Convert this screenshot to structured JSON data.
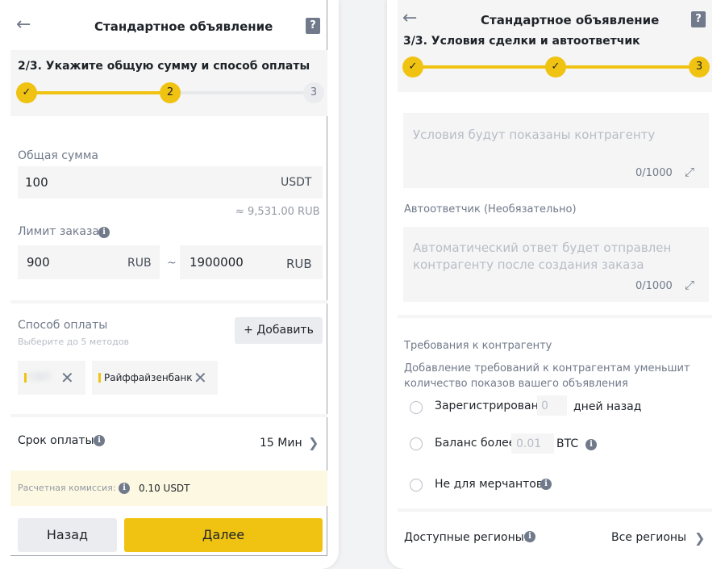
{
  "left": {
    "header": {
      "back_icon": "arrow-left-icon",
      "title": "Стандартное объявление",
      "help_icon": "help-book-icon"
    },
    "step": {
      "title": "2/3. Укажите общую сумму и способ оплаты",
      "current": "2",
      "last": "3",
      "done_icon": "check-icon"
    },
    "total": {
      "label": "Общая сумма",
      "value": "100",
      "unit": "USDT",
      "approx": "≈ 9,531.00 RUB"
    },
    "limit": {
      "label": "Лимит заказа",
      "min": "900",
      "min_unit": "RUB",
      "separator": "~",
      "max": "1900000",
      "max_unit": "RUB"
    },
    "payment": {
      "label": "Способ оплаты",
      "hint": "Выберите до 5 методов",
      "add_button": "+ Добавить",
      "methods": [
        {
          "label": "СБП"
        },
        {
          "label": "Райффайзенбанк"
        }
      ]
    },
    "payment_time": {
      "label": "Срок оплаты",
      "value": "15 Мин"
    },
    "fee": {
      "label": "Расчетная комиссия:",
      "value": "0.10 USDT"
    },
    "buttons": {
      "back": "Назад",
      "next": "Далее"
    }
  },
  "right": {
    "header": {
      "back_icon": "arrow-left-icon",
      "title": "Стандартное объявление",
      "help_icon": "help-book-icon"
    },
    "step": {
      "title": "3/3. Условия сделки и автоответчик",
      "current": "3",
      "done_icon": "check-icon"
    },
    "terms": {
      "placeholder": "Условия будут показаны контрагенту",
      "counter": "0/1000"
    },
    "auto_reply": {
      "label": "Автоответчик (Необязательно)",
      "placeholder": "Автоматический ответ будет отправлен контрагенту после создания заказа",
      "counter": "0/1000"
    },
    "requirements": {
      "title": "Требования к контрагенту",
      "hint": "Добавление требований к контрагентам уменьшит количество показов вашего объявления",
      "registered_label": "Зарегистрирован",
      "registered_value": "0",
      "registered_suffix": "дней назад",
      "balance_label": "Баланс более",
      "balance_value": "0.01",
      "balance_unit": "BTC",
      "not_merchants": "Не для мерчантов"
    },
    "regions": {
      "label": "Доступные регионы:",
      "value": "Все регионы"
    }
  },
  "colors": {
    "accent": "#f0c312",
    "text": "#1e2329",
    "muted": "#707a8a",
    "field": "#f5f5f5",
    "fee_bg": "#fdf8e1"
  }
}
